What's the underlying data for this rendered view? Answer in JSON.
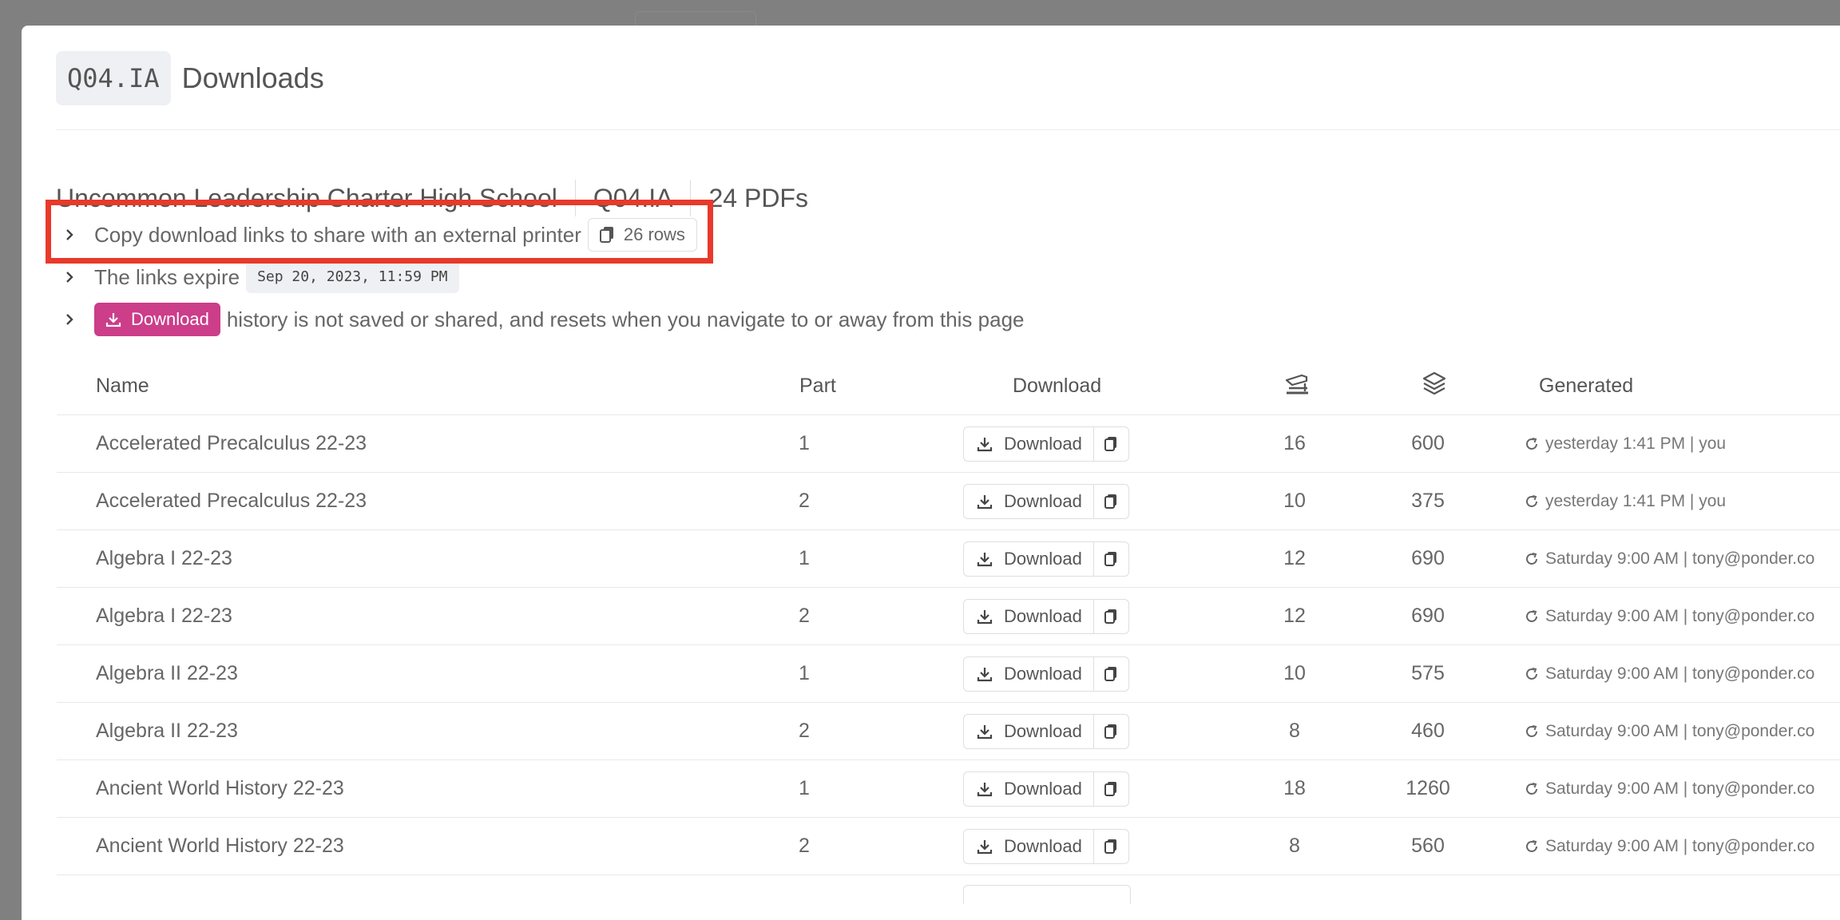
{
  "modal": {
    "code": "Q04.IA",
    "title": "Downloads"
  },
  "info": {
    "school": "Uncommon Leadership Charter High School",
    "code": "Q04.IA",
    "pdf_count": "24 PDFs"
  },
  "disclosures": {
    "copy_links": {
      "text": "Copy download links to share with an external printer",
      "button_label": "26 rows"
    },
    "expire": {
      "text": "The links expire",
      "date": "Sep 20, 2023, 11:59 PM"
    },
    "history": {
      "button_label": "Download",
      "text": "history is not saved or shared, and resets when you navigate to or away from this page"
    }
  },
  "table": {
    "headers": {
      "name": "Name",
      "part": "Part",
      "download": "Download",
      "staples_icon": "stapler-icon",
      "pages_icon": "layers-icon",
      "generated": "Generated"
    },
    "download_label": "Download",
    "rows": [
      {
        "name": "Accelerated Precalculus 22-23",
        "part": "1",
        "staples": "16",
        "pages": "600",
        "generated": "yesterday 1:41 PM | you"
      },
      {
        "name": "Accelerated Precalculus 22-23",
        "part": "2",
        "staples": "10",
        "pages": "375",
        "generated": "yesterday 1:41 PM | you"
      },
      {
        "name": "Algebra I 22-23",
        "part": "1",
        "staples": "12",
        "pages": "690",
        "generated": "Saturday 9:00 AM | tony@ponder.co"
      },
      {
        "name": "Algebra I 22-23",
        "part": "2",
        "staples": "12",
        "pages": "690",
        "generated": "Saturday 9:00 AM | tony@ponder.co"
      },
      {
        "name": "Algebra II 22-23",
        "part": "1",
        "staples": "10",
        "pages": "575",
        "generated": "Saturday 9:00 AM | tony@ponder.co"
      },
      {
        "name": "Algebra II 22-23",
        "part": "2",
        "staples": "8",
        "pages": "460",
        "generated": "Saturday 9:00 AM | tony@ponder.co"
      },
      {
        "name": "Ancient World History 22-23",
        "part": "1",
        "staples": "18",
        "pages": "1260",
        "generated": "Saturday 9:00 AM | tony@ponder.co"
      },
      {
        "name": "Ancient World History 22-23",
        "part": "2",
        "staples": "8",
        "pages": "560",
        "generated": "Saturday 9:00 AM | tony@ponder.co"
      }
    ]
  },
  "colors": {
    "accent_pink": "#cc3d8a",
    "highlight_red": "#e8392b",
    "backdrop": "#808080"
  }
}
